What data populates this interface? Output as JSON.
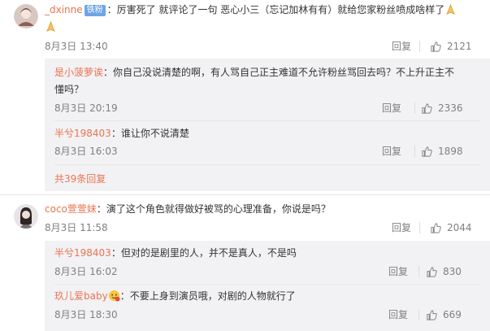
{
  "comments": [
    {
      "username": "_dxinne",
      "badge": "铁粉",
      "text_line1": "：厉害死了 就评论了一句 恶心小三（忘记加林有有）就给您家粉丝喷成啥样了",
      "date": "8月3日 13:40",
      "reply_label": "回复",
      "likes": "2121",
      "replies": [
        {
          "username": "是小菠萝诶",
          "text_line1": "：你自己没说清楚的啊，有人骂自己正主难道不允许粉丝骂回去吗？不上升正主不",
          "text_line2": "懂吗？",
          "date": "8月3日 20:19",
          "reply_label": "回复",
          "likes": "2336"
        },
        {
          "username": "半兮198403",
          "text_line1": "：谁让你不说清楚",
          "date": "8月3日 16:03",
          "reply_label": "回复",
          "likes": "1898"
        }
      ],
      "more_replies": "共39条回复"
    },
    {
      "username": "coco萱萱妹",
      "text_line1": "：演了这个角色就得做好被骂的心理准备，你说是吗？",
      "date": "8月3日 11:58",
      "reply_label": "回复",
      "likes": "2044",
      "replies": [
        {
          "username": "半兮198403",
          "text_line1": "：但对的是剧里的人，并不是真人，不是吗",
          "date": "8月3日 16:02",
          "reply_label": "回复",
          "likes": "830"
        },
        {
          "username": "玖儿爱baby",
          "text_line1": "：不要上身到演员哦，对剧的人物就行了",
          "date": "8月3日 18:30",
          "reply_label": "回复",
          "likes": "669"
        }
      ]
    }
  ],
  "colors": {
    "username": "#eb7350",
    "badge": "#6ea5e5",
    "reply_bg": "#f2f2f5"
  }
}
